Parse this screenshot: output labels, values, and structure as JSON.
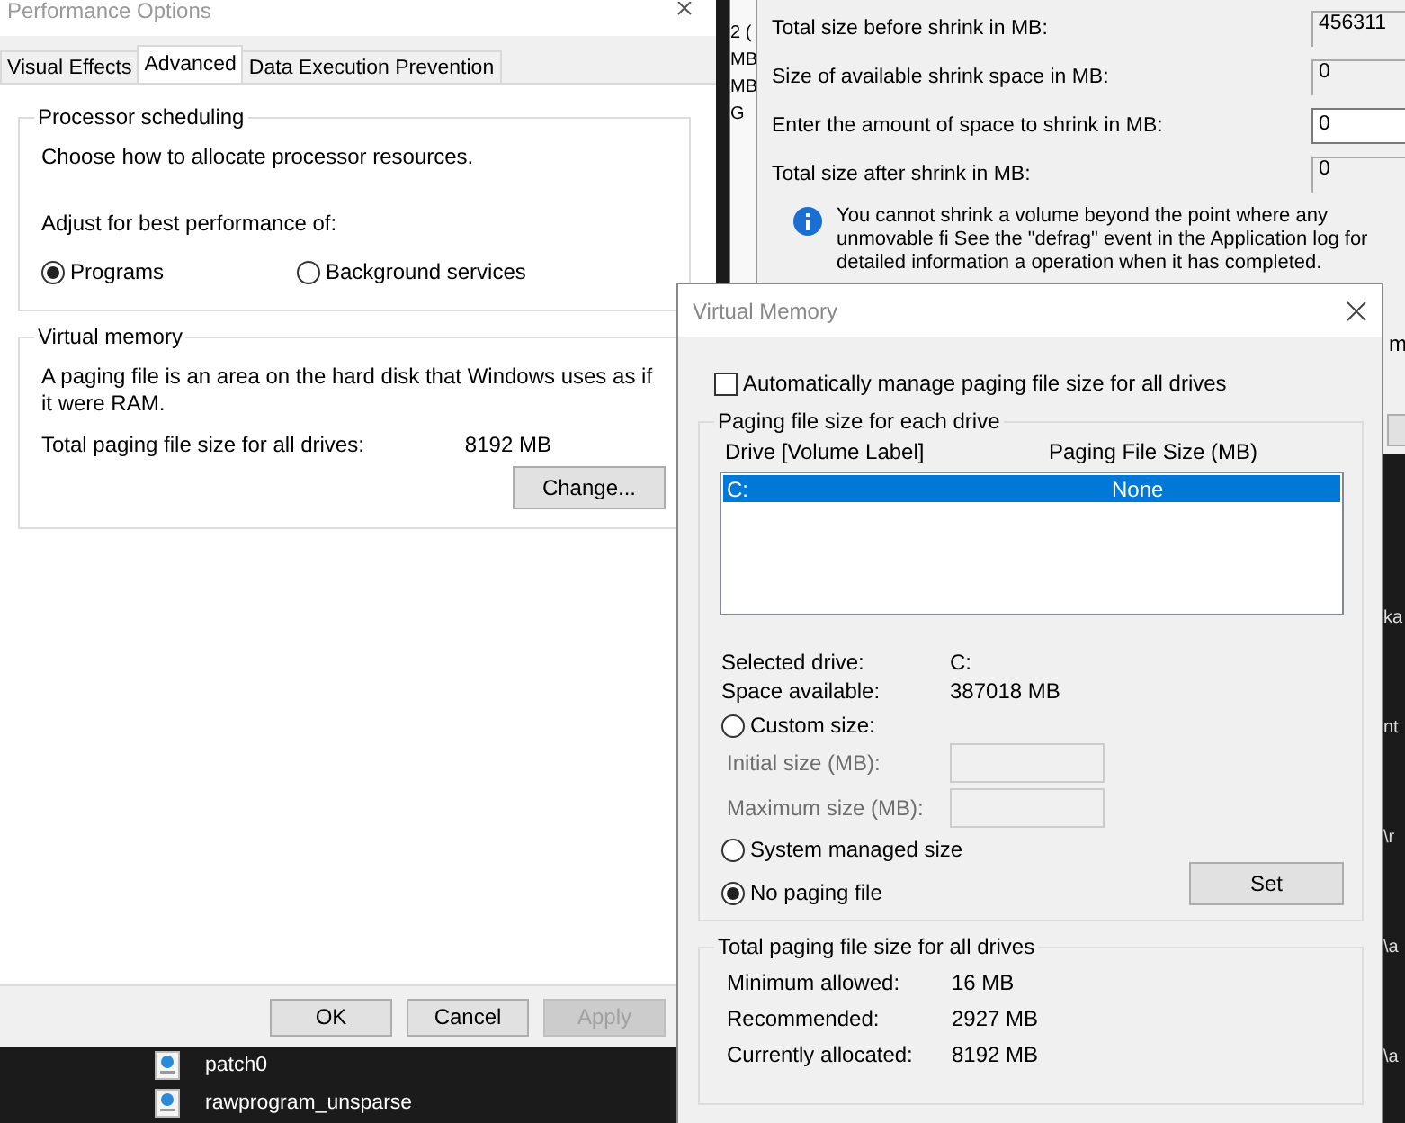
{
  "performance_options": {
    "title": "Performance Options",
    "tabs": [
      {
        "label": "Visual Effects",
        "selected": false
      },
      {
        "label": "Advanced",
        "selected": true
      },
      {
        "label": "Data Execution Prevention",
        "selected": false
      }
    ],
    "processor_scheduling": {
      "heading": "Processor scheduling",
      "description": "Choose how to allocate processor resources.",
      "adjust_label": "Adjust for best performance of:",
      "options": [
        {
          "label": "Programs",
          "selected": true
        },
        {
          "label": "Background services",
          "selected": false
        }
      ]
    },
    "virtual_memory": {
      "heading": "Virtual memory",
      "description": "A paging file is an area on the hard disk that Windows uses as if it were RAM.",
      "total_label": "Total paging file size for all drives:",
      "total_value": "8192 MB",
      "change_button": "Change..."
    },
    "buttons": [
      {
        "label": "OK",
        "disabled": false
      },
      {
        "label": "Cancel",
        "disabled": false
      },
      {
        "label": "Apply",
        "disabled": true
      }
    ]
  },
  "shrink_dialog": {
    "side_fragments": [
      "2 (",
      "MB",
      "MB",
      "G"
    ],
    "fields": [
      {
        "label": "Total size before shrink in MB:",
        "value": "456311",
        "editable": false
      },
      {
        "label": "Size of available shrink space in MB:",
        "value": "0",
        "editable": false
      },
      {
        "label": "Enter the amount of space to shrink in MB:",
        "value": "0",
        "editable": true
      },
      {
        "label": "Total size after shrink in MB:",
        "value": "0",
        "editable": false
      }
    ],
    "info": "You cannot shrink a volume beyond the point where any unmovable fi See the \"defrag\" event in the Application log for detailed information a operation when it has completed.",
    "edge_fragment": "m"
  },
  "virtual_memory_dialog": {
    "title": "Virtual Memory",
    "auto_manage": {
      "label": "Automatically manage paging file size for all drives",
      "checked": false
    },
    "drive_group": {
      "heading": "Paging file size for each drive",
      "columns": [
        "Drive  [Volume Label]",
        "Paging File Size (MB)"
      ],
      "rows": [
        {
          "drive": "C:",
          "size": "None",
          "selected": true
        }
      ],
      "selected_drive_label": "Selected drive:",
      "selected_drive_value": "C:",
      "space_label": "Space available:",
      "space_value": "387018 MB",
      "options": [
        {
          "kind": "custom",
          "label": "Custom size:",
          "selected": false
        },
        {
          "kind": "system",
          "label": "System managed size",
          "selected": false
        },
        {
          "kind": "none",
          "label": "No paging file",
          "selected": true
        }
      ],
      "size_fields": [
        {
          "label": "Initial size (MB):",
          "disabled": true
        },
        {
          "label": "Maximum size (MB):",
          "disabled": true
        }
      ],
      "set_button": "Set"
    },
    "total_group": {
      "heading": "Total paging file size for all drives",
      "rows": [
        {
          "label": "Minimum allowed:",
          "value": "16 MB"
        },
        {
          "label": "Recommended:",
          "value": "2927 MB"
        },
        {
          "label": "Currently allocated:",
          "value": "8192 MB"
        }
      ]
    }
  },
  "file_list": [
    "patch0",
    "rawprogram_unsparse"
  ],
  "terminal_fragments": [
    "ka",
    "nt",
    "\\r",
    "\\a",
    "\\a"
  ]
}
